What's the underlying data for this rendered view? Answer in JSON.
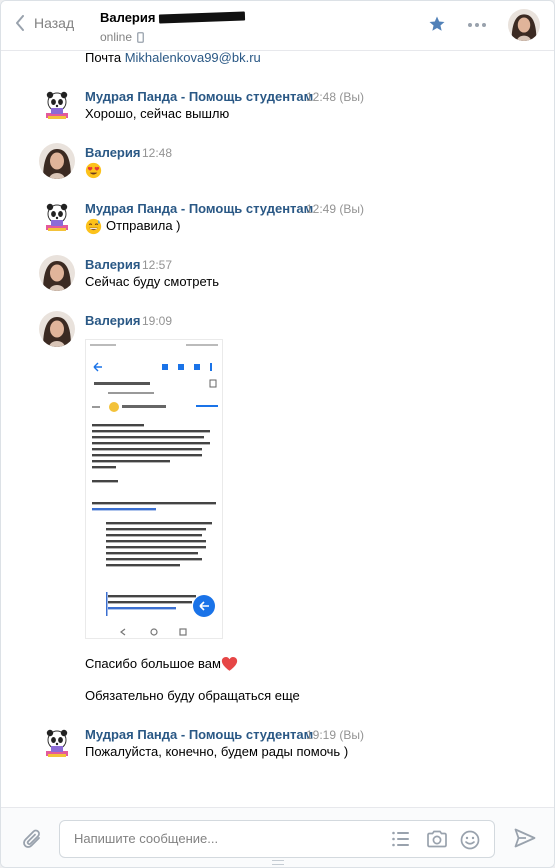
{
  "header": {
    "back_label": "Назад",
    "peer_name": "Валерия",
    "peer_status": "online"
  },
  "messages": [
    {
      "kind": "continuation",
      "text_prefix": "Почта ",
      "link": "Mikhalenkova99@bk.ru"
    },
    {
      "kind": "head",
      "author": "Мудрая Панда - Помощь студентам",
      "time": "12:48",
      "you_tag": "(Вы)",
      "text": "Хорошо, сейчас вышлю"
    },
    {
      "kind": "head",
      "author": "Валерия",
      "time": "12:48",
      "emoji": "heart-eyes-emoji"
    },
    {
      "kind": "head",
      "author": "Мудрая Панда - Помощь студентам",
      "time": "12:49",
      "you_tag": "(Вы)",
      "text": "Отправила )",
      "emoji": "sweat-smile-emoji"
    },
    {
      "kind": "head",
      "author": "Валерия",
      "time": "12:57",
      "text": "Сейчас буду смотреть"
    },
    {
      "kind": "head",
      "author": "Валерия",
      "time": "19:09",
      "attachment": "photo-attachment"
    },
    {
      "kind": "continuation",
      "text": "Спасибо большое вам",
      "emoji": "red-heart-emoji"
    },
    {
      "kind": "continuation",
      "text": "Обязательно буду обращаться еще"
    },
    {
      "kind": "head",
      "author": "Мудрая Панда - Помощь студентам",
      "time": "19:19",
      "you_tag": "(Вы)",
      "text": "Пожалуйста, конечно, будем рады помочь )"
    }
  ],
  "composer": {
    "placeholder": "Напишите сообщение..."
  },
  "colors": {
    "link": "#2a5885",
    "accent": "#5181b8",
    "muted": "#828282",
    "heart": "#e64646"
  }
}
